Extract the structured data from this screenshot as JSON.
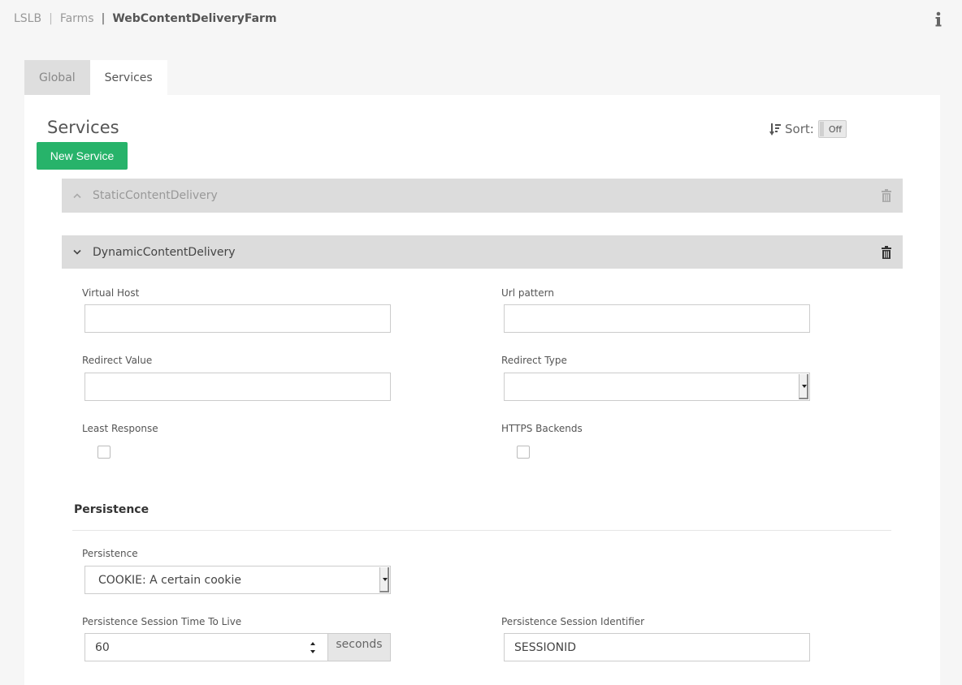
{
  "breadcrumb": {
    "items": [
      "LSLB",
      "Farms"
    ],
    "separator": "|",
    "current": "WebContentDeliveryFarm"
  },
  "tabs": [
    {
      "label": "Global",
      "active": false
    },
    {
      "label": "Services",
      "active": true
    }
  ],
  "panel": {
    "title": "Services",
    "sort_label": "Sort:",
    "sort_toggle": "Off",
    "new_service_label": "New Service"
  },
  "services": [
    {
      "name": "StaticContentDelivery",
      "expanded": false
    },
    {
      "name": "DynamicContentDelivery",
      "expanded": true
    }
  ],
  "form": {
    "virtual_host": {
      "label": "Virtual Host",
      "value": ""
    },
    "url_pattern": {
      "label": "Url pattern",
      "value": ""
    },
    "redirect_value": {
      "label": "Redirect Value",
      "value": ""
    },
    "redirect_type": {
      "label": "Redirect Type",
      "value": ""
    },
    "least_response": {
      "label": "Least Response",
      "checked": false
    },
    "https_backends": {
      "label": "HTTPS Backends",
      "checked": false
    }
  },
  "persistence": {
    "section_title": "Persistence",
    "persistence": {
      "label": "Persistence",
      "value": "COOKIE: A certain cookie"
    },
    "ttl": {
      "label": "Persistence Session Time To Live",
      "value": "60",
      "unit": "seconds"
    },
    "session_id": {
      "label": "Persistence Session Identifier",
      "value": "SESSIONID"
    }
  },
  "colors": {
    "accent": "#27b36a",
    "row_bg": "#dcdcdc",
    "page_bg": "#f6f6f6"
  },
  "icons": {
    "info": "info-icon",
    "sort": "sort-icon",
    "collapse": "chevron-up-icon",
    "expand": "chevron-down-icon",
    "delete": "trash-icon"
  }
}
